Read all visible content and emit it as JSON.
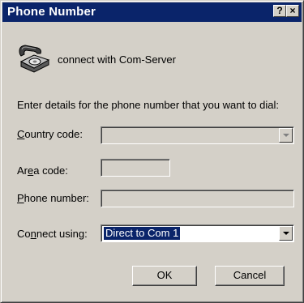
{
  "window": {
    "title": "Phone Number",
    "help_glyph": "?",
    "close_glyph": "×"
  },
  "header": {
    "icon": "phone-icon",
    "label": "connect with Com-Server"
  },
  "instructions": "Enter details for the phone number that you want to dial:",
  "fields": {
    "country_code": {
      "label_pre": "",
      "label_key": "C",
      "label_post": "ountry code:",
      "value": "",
      "disabled": true
    },
    "area_code": {
      "label_pre": "Ar",
      "label_key": "e",
      "label_post": "a code:",
      "value": "",
      "disabled": true
    },
    "phone_number": {
      "label_pre": "",
      "label_key": "P",
      "label_post": "hone number:",
      "value": "",
      "disabled": true
    },
    "connect_using": {
      "label_pre": "Co",
      "label_key": "n",
      "label_post": "nect using:",
      "value": "Direct to Com 1",
      "disabled": false
    }
  },
  "buttons": {
    "ok": "OK",
    "cancel": "Cancel"
  },
  "colors": {
    "titlebar": "#0a246a",
    "face": "#d4d0c8",
    "selection": "#0a246a"
  }
}
